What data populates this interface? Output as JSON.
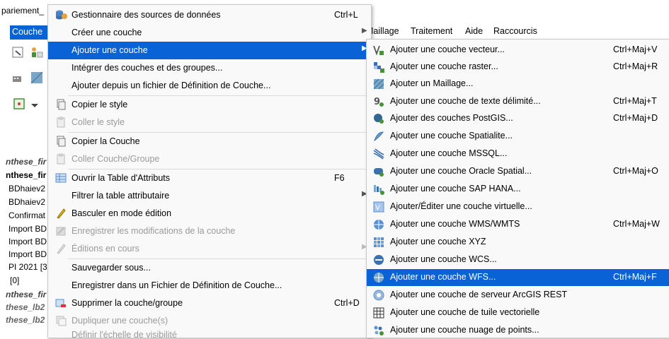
{
  "background": {
    "title_fragment": "pariement_",
    "menubar": {
      "couche": "Couche",
      "maillage": "Maillage",
      "traitement": "Traitement",
      "aide": "Aide",
      "raccourcis": "Raccourcis"
    },
    "layers": [
      "nthese_fir",
      "nthese_fir",
      "BDhaiev2",
      "BDhaiev2",
      "Confirmat",
      "Import BD",
      "Import BD",
      "Import BD",
      "PI 2021 [3",
      "[0]",
      "nthese_fir",
      "these_lb2",
      "these_lb2"
    ]
  },
  "main_menu": {
    "items": [
      {
        "label": "Gestionnaire des sources de données",
        "shortcut": "Ctrl+L",
        "icon": "database-icon"
      },
      {
        "label": "Créer une couche",
        "icon": "none"
      },
      {
        "label": "Ajouter une couche",
        "icon": "none"
      },
      {
        "label": "Intégrer des couches et des groupes...",
        "icon": "none"
      },
      {
        "label": "Ajouter depuis un fichier de Définition de Couche...",
        "icon": "none"
      },
      {
        "label": "Copier le style",
        "icon": "copy-icon"
      },
      {
        "label": "Coller le style",
        "icon": "paste-icon"
      },
      {
        "label": "Copier la Couche",
        "icon": "copy-icon"
      },
      {
        "label": "Coller Couche/Groupe",
        "icon": "paste-icon"
      },
      {
        "label": "Ouvrir la Table d'Attributs",
        "shortcut": "F6",
        "icon": "table-icon"
      },
      {
        "label": "Filtrer la table attributaire",
        "icon": "none"
      },
      {
        "label": "Basculer en mode édition",
        "icon": "pencil-icon"
      },
      {
        "label": "Enregistrer les modifications de la couche",
        "icon": "save-edits-icon"
      },
      {
        "label": "Éditions en cours",
        "icon": "edits-icon"
      },
      {
        "label": "Sauvegarder sous...",
        "icon": "none"
      },
      {
        "label": "Enregistrer dans un Fichier de Définition de Couche...",
        "icon": "none"
      },
      {
        "label": "Supprimer la couche/groupe",
        "shortcut": "Ctrl+D",
        "icon": "remove-layer-icon"
      },
      {
        "label": "Dupliquer une couche(s)",
        "icon": "duplicate-icon"
      },
      {
        "label": "Définir l'échelle de visibilité",
        "icon": "none"
      }
    ]
  },
  "sub_menu": {
    "items": [
      {
        "label": "Ajouter une couche vecteur...",
        "shortcut": "Ctrl+Maj+V",
        "icon": "vector-layer-icon"
      },
      {
        "label": "Ajouter une couche raster...",
        "shortcut": "Ctrl+Maj+R",
        "icon": "raster-layer-icon"
      },
      {
        "label": "Ajouter un Maillage...",
        "icon": "mesh-layer-icon"
      },
      {
        "label": "Ajouter une couche de texte délimité...",
        "shortcut": "Ctrl+Maj+T",
        "icon": "delimited-text-icon"
      },
      {
        "label": "Ajouter des couches PostGIS...",
        "shortcut": "Ctrl+Maj+D",
        "icon": "postgis-icon"
      },
      {
        "label": "Ajouter une couche Spatialite...",
        "icon": "spatialite-icon"
      },
      {
        "label": "Ajouter une couche MSSQL...",
        "icon": "mssql-icon"
      },
      {
        "label": "Ajouter une couche Oracle Spatial...",
        "shortcut": "Ctrl+Maj+O",
        "icon": "oracle-icon"
      },
      {
        "label": "Ajouter une couche SAP HANA...",
        "icon": "hana-icon"
      },
      {
        "label": "Ajouter/Éditer une couche virtuelle...",
        "icon": "virtual-layer-icon"
      },
      {
        "label": "Ajouter une couche WMS/WMTS",
        "shortcut": "Ctrl+Maj+W",
        "icon": "wms-icon"
      },
      {
        "label": "Ajouter une couche XYZ",
        "icon": "xyz-icon"
      },
      {
        "label": "Ajouter une couche WCS...",
        "icon": "wcs-icon"
      },
      {
        "label": "Ajouter une couche WFS...",
        "shortcut": "Ctrl+Maj+F",
        "icon": "wfs-icon"
      },
      {
        "label": "Ajouter une couche de serveur ArcGIS REST",
        "icon": "arcgis-icon"
      },
      {
        "label": "Ajouter une couche de tuile vectorielle",
        "icon": "vector-tile-icon"
      },
      {
        "label": "Ajouter une couche nuage de points...",
        "icon": "point-cloud-icon"
      }
    ]
  },
  "colors": {
    "highlight": "#0a63d6",
    "menu_bg": "#f9f9f9",
    "disabled_text": "#9a9a9a"
  }
}
